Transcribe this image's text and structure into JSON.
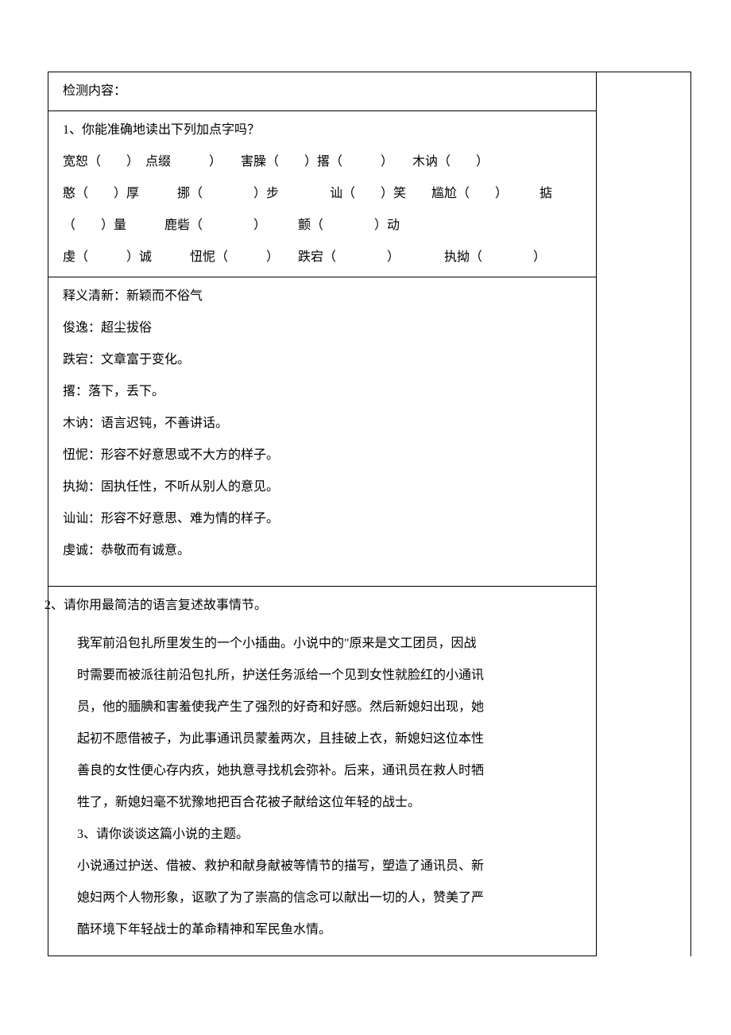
{
  "header": {
    "title": "检测内容："
  },
  "q1": {
    "prompt": "1、你能准确地读出下列加点字吗？",
    "lines": [
      "宽恕（　　）　点缀　　　）　　害臊（　　）撂（　　　）　　木讷（　　）",
      "憨（　　）厚　　　挪（　　　　）步　　　　讪（　　）笑　　尴尬（　　）　　　掂",
      "（　　）量　　　鹿砦（　　　　）　　　颤（　　　　）动",
      "虔（　　　）诚　　　忸怩（　　　）　　跌宕（　　　　）　　　　执拗（　　　　）"
    ]
  },
  "definitions": [
    "释义清新：新颖而不俗气",
    "俊逸：超尘拔俗",
    "跌宕：文章富于变化。",
    "撂：落下，丢下。",
    "木讷：语言迟钝，不善讲话。",
    "忸怩：形容不好意思或不大方的样子。",
    "执拗：固执任性，不听从别人的意见。",
    "讪讪：形容不好意思、难为情的样子。",
    "虔诚：恭敬而有诚意。"
  ],
  "q2": {
    "prompt": "2、请你用最简洁的语言复述故事情节。",
    "body": [
      "我军前沿包扎所里发生的一个小插曲。小说中的\"原来是文工团员，因战",
      "时需要而被派往前沿包扎所，护送任务派给一个见到女性就脸红的小通讯",
      "员，他的腼腆和害羞使我产生了强烈的好奇和好感。然后新媳妇出现，她",
      "起初不愿借被子，为此事通讯员蒙羞两次，且挂破上衣，新媳妇这位本性",
      "善良的女性便心存内疚，她执意寻找机会弥补。后来，通讯员在救人时牺",
      "牲了，新媳妇毫不犹豫地把百合花被子献给这位年轻的战士。"
    ]
  },
  "q3": {
    "prompt": "3、请你谈谈这篇小说的主题。",
    "body": [
      "小说通过护送、借被、救护和献身献被等情节的描写，塑造了通讯员、新",
      "媳妇两个人物形象，讴歌了为了崇高的信念可以献出一切的人，赞美了严",
      "酷环境下年轻战士的革命精神和军民鱼水情。"
    ]
  }
}
